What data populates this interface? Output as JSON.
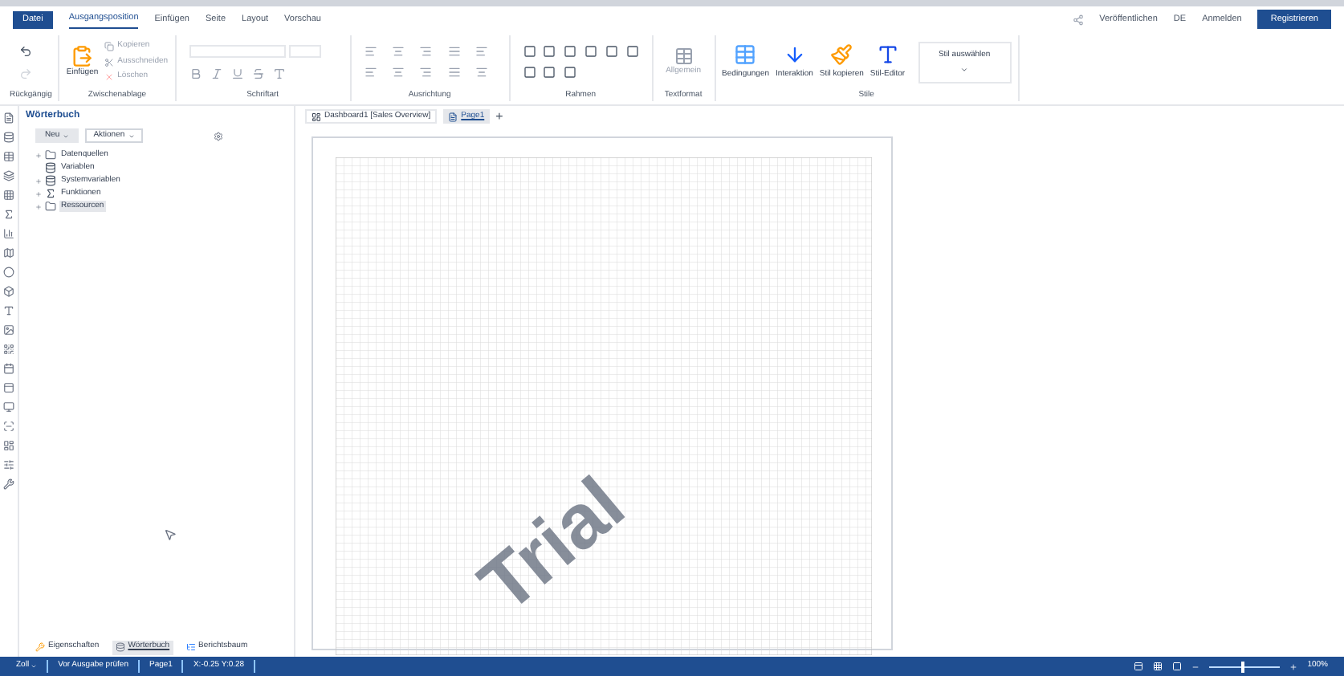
{
  "menu_tabs": [
    {
      "label": "Datei",
      "kind": "file",
      "selected": false
    },
    {
      "label": "Ausgangsposition",
      "kind": "tab",
      "selected": true
    },
    {
      "label": "Einfügen",
      "kind": "tab",
      "selected": false
    },
    {
      "label": "Seite",
      "kind": "tab",
      "selected": false
    },
    {
      "label": "Layout",
      "kind": "tab",
      "selected": false
    },
    {
      "label": "Vorschau",
      "kind": "tab",
      "selected": false
    }
  ],
  "top_right": {
    "publish": "Veröffentlichen",
    "language": "DE",
    "login": "Anmelden",
    "register": "Registrieren"
  },
  "ribbon": {
    "undo_group": "Rückgängig",
    "clipboard": {
      "label": "Zwischenablage",
      "paste": "Einfügen",
      "items": [
        {
          "label": "Kopieren",
          "disabled": true
        },
        {
          "label": "Ausschneiden",
          "disabled": true
        },
        {
          "label": "Löschen",
          "disabled": true
        }
      ]
    },
    "font_group": "Schriftart",
    "alignment_group": "Ausrichtung",
    "borders_group": "Rahmen",
    "text_format": {
      "label": "Textformat",
      "button": "Allgemein",
      "disabled": true
    },
    "styles": {
      "label": "Stile",
      "buttons": [
        {
          "label": "Bedingungen",
          "kind": "conditions"
        },
        {
          "label": "Interaktion",
          "kind": "interaction"
        },
        {
          "label": "Stil kopieren",
          "kind": "brush"
        },
        {
          "label": "Stil-Editor",
          "kind": "editor"
        }
      ],
      "select": "Stil auswählen"
    }
  },
  "dictionary": {
    "title": "Wörterbuch",
    "new_button": "Neu",
    "actions_button": "Aktionen",
    "tree": [
      {
        "label": "Datenquellen",
        "kind": "folder",
        "expandable": true,
        "selected": false
      },
      {
        "label": "Variablen",
        "kind": "variables",
        "expandable": false,
        "selected": false
      },
      {
        "label": "Systemvariablen",
        "kind": "system",
        "expandable": true,
        "selected": false
      },
      {
        "label": "Funktionen",
        "kind": "functions",
        "expandable": true,
        "selected": false
      },
      {
        "label": "Ressourcen",
        "kind": "resources",
        "expandable": true,
        "selected": true
      }
    ]
  },
  "panel_tabs": [
    {
      "label": "Eigenschaften",
      "selected": false
    },
    {
      "label": "Wörterbuch",
      "selected": true
    },
    {
      "label": "Berichtsbaum",
      "selected": false
    }
  ],
  "document_tabs": [
    {
      "label": "Dashboard1 [Sales Overview]",
      "kind": "dashboard",
      "selected": false
    },
    {
      "label": "Page1",
      "kind": "page",
      "selected": true
    }
  ],
  "add_tab": "+",
  "canvas": {
    "watermark": "Trial"
  },
  "status_bar": {
    "units": "Zoll",
    "check": "Vor Ausgabe prüfen",
    "page": "Page1",
    "position": "X:-0.25 Y:0.28",
    "zoom": {
      "level": 0.45,
      "reading": "100%"
    }
  }
}
